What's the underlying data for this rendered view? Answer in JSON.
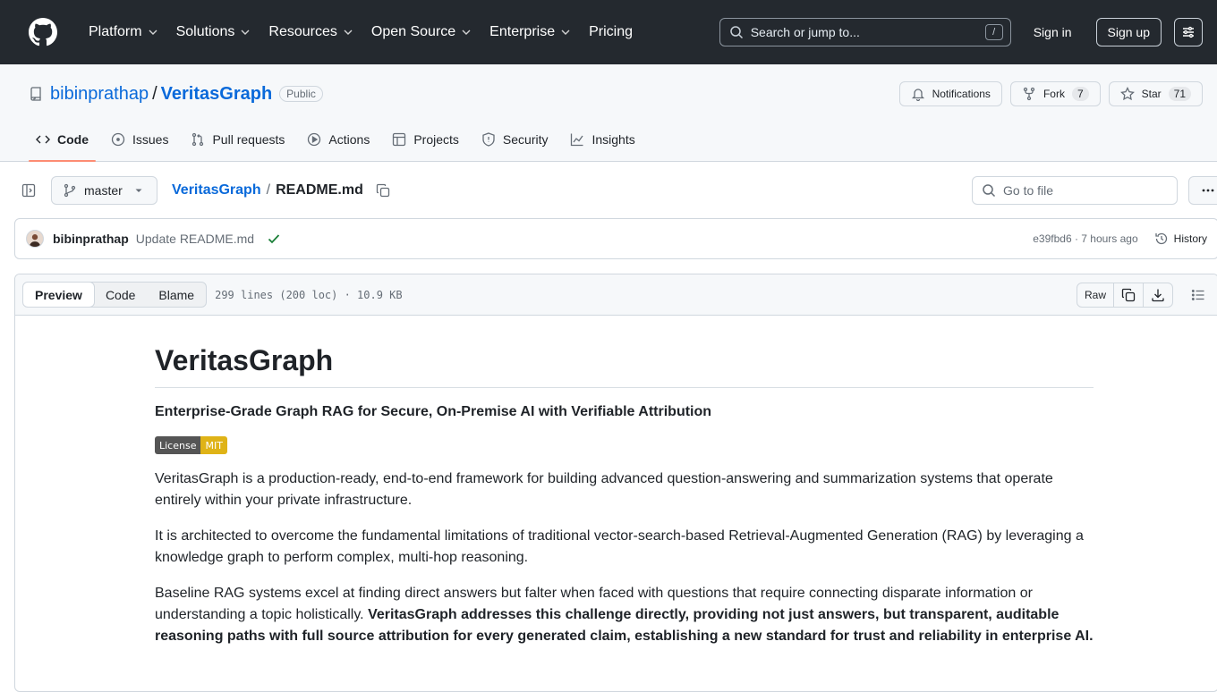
{
  "header": {
    "nav": [
      "Platform",
      "Solutions",
      "Resources",
      "Open Source",
      "Enterprise",
      "Pricing"
    ],
    "search_placeholder": "Search or jump to...",
    "search_key": "/",
    "sign_in": "Sign in",
    "sign_up": "Sign up"
  },
  "repo": {
    "owner": "bibinprathap",
    "separator": "/",
    "name": "VeritasGraph",
    "visibility": "Public",
    "notifications_label": "Notifications",
    "fork_label": "Fork",
    "fork_count": "7",
    "star_label": "Star",
    "star_count": "71"
  },
  "tabs": {
    "code": "Code",
    "issues": "Issues",
    "pull_requests": "Pull requests",
    "actions": "Actions",
    "projects": "Projects",
    "security": "Security",
    "insights": "Insights"
  },
  "filenav": {
    "branch": "master",
    "crumb_repo": "VeritasGraph",
    "crumb_sep": "/",
    "crumb_file": "README.md",
    "goto_placeholder": "Go to file"
  },
  "commit": {
    "author": "bibinprathap",
    "message": "Update README.md",
    "meta": "e39fbd6 · 7 hours ago",
    "history": "History"
  },
  "viewer": {
    "preview": "Preview",
    "code": "Code",
    "blame": "Blame",
    "info": "299 lines (200 loc) · 10.9 KB",
    "raw": "Raw"
  },
  "readme": {
    "title": "VeritasGraph",
    "subtitle": "Enterprise-Grade Graph RAG for Secure, On-Premise AI with Verifiable Attribution",
    "badge_left": "License",
    "badge_right": "MIT",
    "p1": "VeritasGraph is a production-ready, end-to-end framework for building advanced question-answering and summarization systems that operate entirely within your private infrastructure.",
    "p2": "It is architected to overcome the fundamental limitations of traditional vector-search-based Retrieval-Augmented Generation (RAG) by leveraging a knowledge graph to perform complex, multi-hop reasoning.",
    "p3_plain": "Baseline RAG systems excel at finding direct answers but falter when faced with questions that require connecting disparate information or understanding a topic holistically. ",
    "p3_bold": "VeritasGraph addresses this challenge directly, providing not just answers, but transparent, auditable reasoning paths with full source attribution for every generated claim, establishing a new standard for trust and reliability in enterprise AI."
  },
  "colors": {
    "header_bg": "#24292f",
    "link": "#0969da",
    "tab_underline": "#fd8c73",
    "success": "#1a7f37",
    "badge_mit": "#dfb317"
  }
}
